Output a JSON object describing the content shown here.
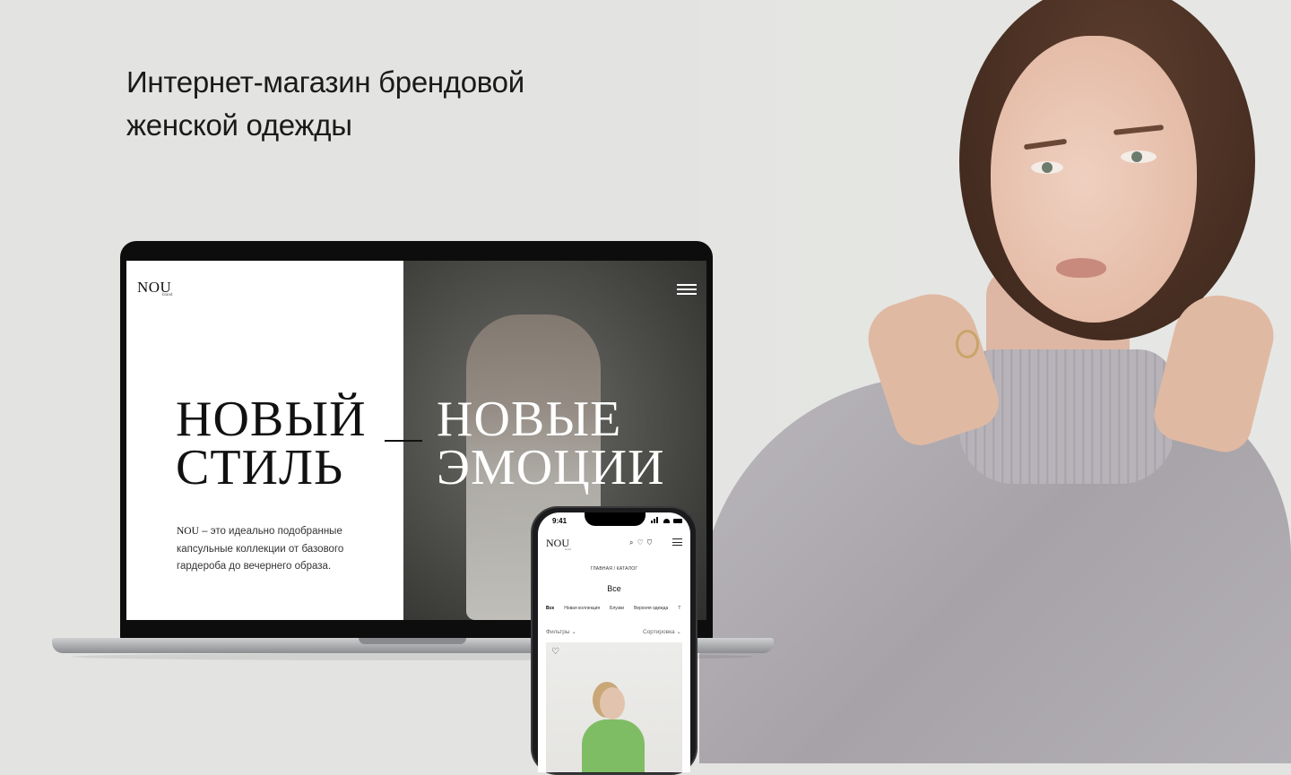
{
  "headline": {
    "line1": "Интернет-магазин брендовой",
    "line2": "женской одежды"
  },
  "laptop": {
    "logo": "NOU",
    "logo_sub": "brand",
    "hero_left": [
      "НОВЫЙ",
      "СТИЛЬ"
    ],
    "hero_right": [
      "НОВЫЕ",
      "ЭМОЦИИ"
    ],
    "desc_brand": "NOU",
    "desc_text": " – это идеально подобранные капсульные коллекции от базового гардероба до вечернего образа.",
    "menu_icon": "hamburger-menu-icon"
  },
  "phone": {
    "time": "9:41",
    "logo": "NOU",
    "logo_sub": "brand",
    "icons": [
      "search-icon",
      "heart-icon",
      "cart-icon",
      "menu-icon"
    ],
    "breadcrumb": "ГЛАВНАЯ / КАТАЛОГ",
    "title": "Все",
    "tabs": [
      "Все",
      "Новая коллекция",
      "Блузки",
      "Верхняя одежда",
      "Т"
    ],
    "filter_label": "Фильтры",
    "sort_label": "Сортировка",
    "card_icon": "heart-icon"
  },
  "colors": {
    "background": "#e3e4e1",
    "text": "#1a1a1a",
    "card_green": "#7fbd64"
  }
}
